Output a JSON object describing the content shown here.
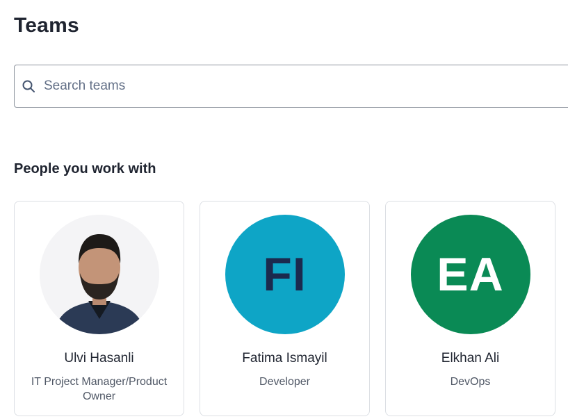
{
  "page": {
    "title": "Teams"
  },
  "search": {
    "placeholder": "Search teams",
    "value": ""
  },
  "section": {
    "heading": "People you work with"
  },
  "people": [
    {
      "name": "Ulvi Hasanli",
      "role": "IT Project Manager/Product Owner",
      "avatar": "photo"
    },
    {
      "name": "Fatima Ismayil",
      "role": "Developer",
      "initials": "FI",
      "avatar_color": "#0ea5c6",
      "initials_color": "#1b2a4e"
    },
    {
      "name": "Elkhan Ali",
      "role": "DevOps",
      "initials": "EA",
      "avatar_color": "#0a8a55",
      "initials_color": "#ffffff"
    }
  ]
}
